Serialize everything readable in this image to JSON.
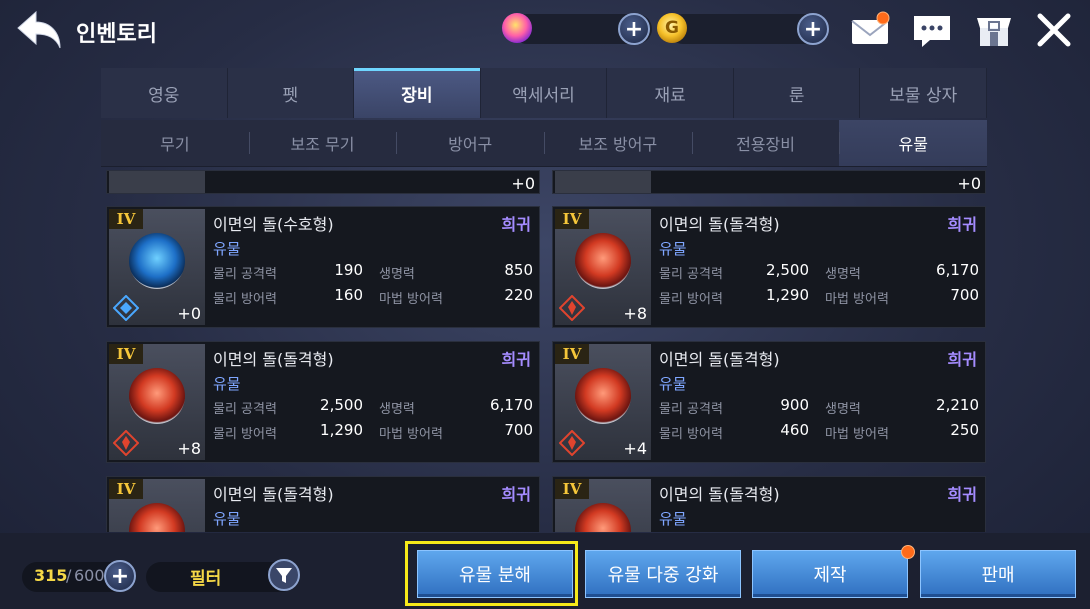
{
  "header": {
    "title": "인벤토리"
  },
  "tabs": [
    {
      "label": "영웅",
      "active": false
    },
    {
      "label": "펫",
      "active": false
    },
    {
      "label": "장비",
      "active": true
    },
    {
      "label": "액세서리",
      "active": false
    },
    {
      "label": "재료",
      "active": false
    },
    {
      "label": "룬",
      "active": false
    },
    {
      "label": "보물 상자",
      "active": false
    }
  ],
  "subtabs": [
    {
      "label": "무기",
      "active": false
    },
    {
      "label": "보조 무기",
      "active": false
    },
    {
      "label": "방어구",
      "active": false
    },
    {
      "label": "보조 방어구",
      "active": false
    },
    {
      "label": "전용장비",
      "active": false
    },
    {
      "label": "유물",
      "active": true
    }
  ],
  "list": {
    "partial_top": [
      {
        "level": "+0"
      },
      {
        "level": "+0"
      }
    ],
    "items": [
      {
        "grade": "IV",
        "name": "이면의 돌(수호형)",
        "rarity": "희귀",
        "category": "유물",
        "type": "shield",
        "stats": [
          {
            "label": "물리 공격력",
            "value": "190"
          },
          {
            "label": "생명력",
            "value": "850"
          },
          {
            "label": "물리 방어력",
            "value": "160"
          },
          {
            "label": "마법 방어력",
            "value": "220"
          }
        ],
        "level": "+0"
      },
      {
        "grade": "IV",
        "name": "이면의 돌(돌격형)",
        "rarity": "희귀",
        "category": "유물",
        "type": "attack",
        "stats": [
          {
            "label": "물리 공격력",
            "value": "2,500"
          },
          {
            "label": "생명력",
            "value": "6,170"
          },
          {
            "label": "물리 방어력",
            "value": "1,290"
          },
          {
            "label": "마법 방어력",
            "value": "700"
          }
        ],
        "level": "+8"
      },
      {
        "grade": "IV",
        "name": "이면의 돌(돌격형)",
        "rarity": "희귀",
        "category": "유물",
        "type": "attack",
        "stats": [
          {
            "label": "물리 공격력",
            "value": "2,500"
          },
          {
            "label": "생명력",
            "value": "6,170"
          },
          {
            "label": "물리 방어력",
            "value": "1,290"
          },
          {
            "label": "마법 방어력",
            "value": "700"
          }
        ],
        "level": "+8"
      },
      {
        "grade": "IV",
        "name": "이면의 돌(돌격형)",
        "rarity": "희귀",
        "category": "유물",
        "type": "attack",
        "stats": [
          {
            "label": "물리 공격력",
            "value": "900"
          },
          {
            "label": "생명력",
            "value": "2,210"
          },
          {
            "label": "물리 방어력",
            "value": "460"
          },
          {
            "label": "마법 방어력",
            "value": "250"
          }
        ],
        "level": "+4"
      },
      {
        "grade": "IV",
        "name": "이면의 돌(돌격형)",
        "rarity": "희귀",
        "category": "유물",
        "type": "attack"
      },
      {
        "grade": "IV",
        "name": "이면의 돌(돌격형)",
        "rarity": "희귀",
        "category": "유물",
        "type": "attack"
      }
    ]
  },
  "footer": {
    "count_current": "315",
    "count_sep": "/",
    "count_max": "600",
    "filter_label": "필터",
    "buttons": [
      {
        "label": "유물 분해"
      },
      {
        "label": "유물 다중 강화"
      },
      {
        "label": "제작"
      },
      {
        "label": "판매"
      }
    ]
  },
  "colors": {
    "accent_blue": "#4f93e0",
    "rarity_purple": "#a58cff",
    "highlight_yellow": "#f7ea19",
    "notify_orange": "#ff6b1a"
  },
  "icons": [
    "back-arrow-icon",
    "gem-currency-icon",
    "gold-currency-icon",
    "mail-icon",
    "chat-icon",
    "shop-icon",
    "close-icon",
    "filter-icon",
    "plus-icon"
  ]
}
